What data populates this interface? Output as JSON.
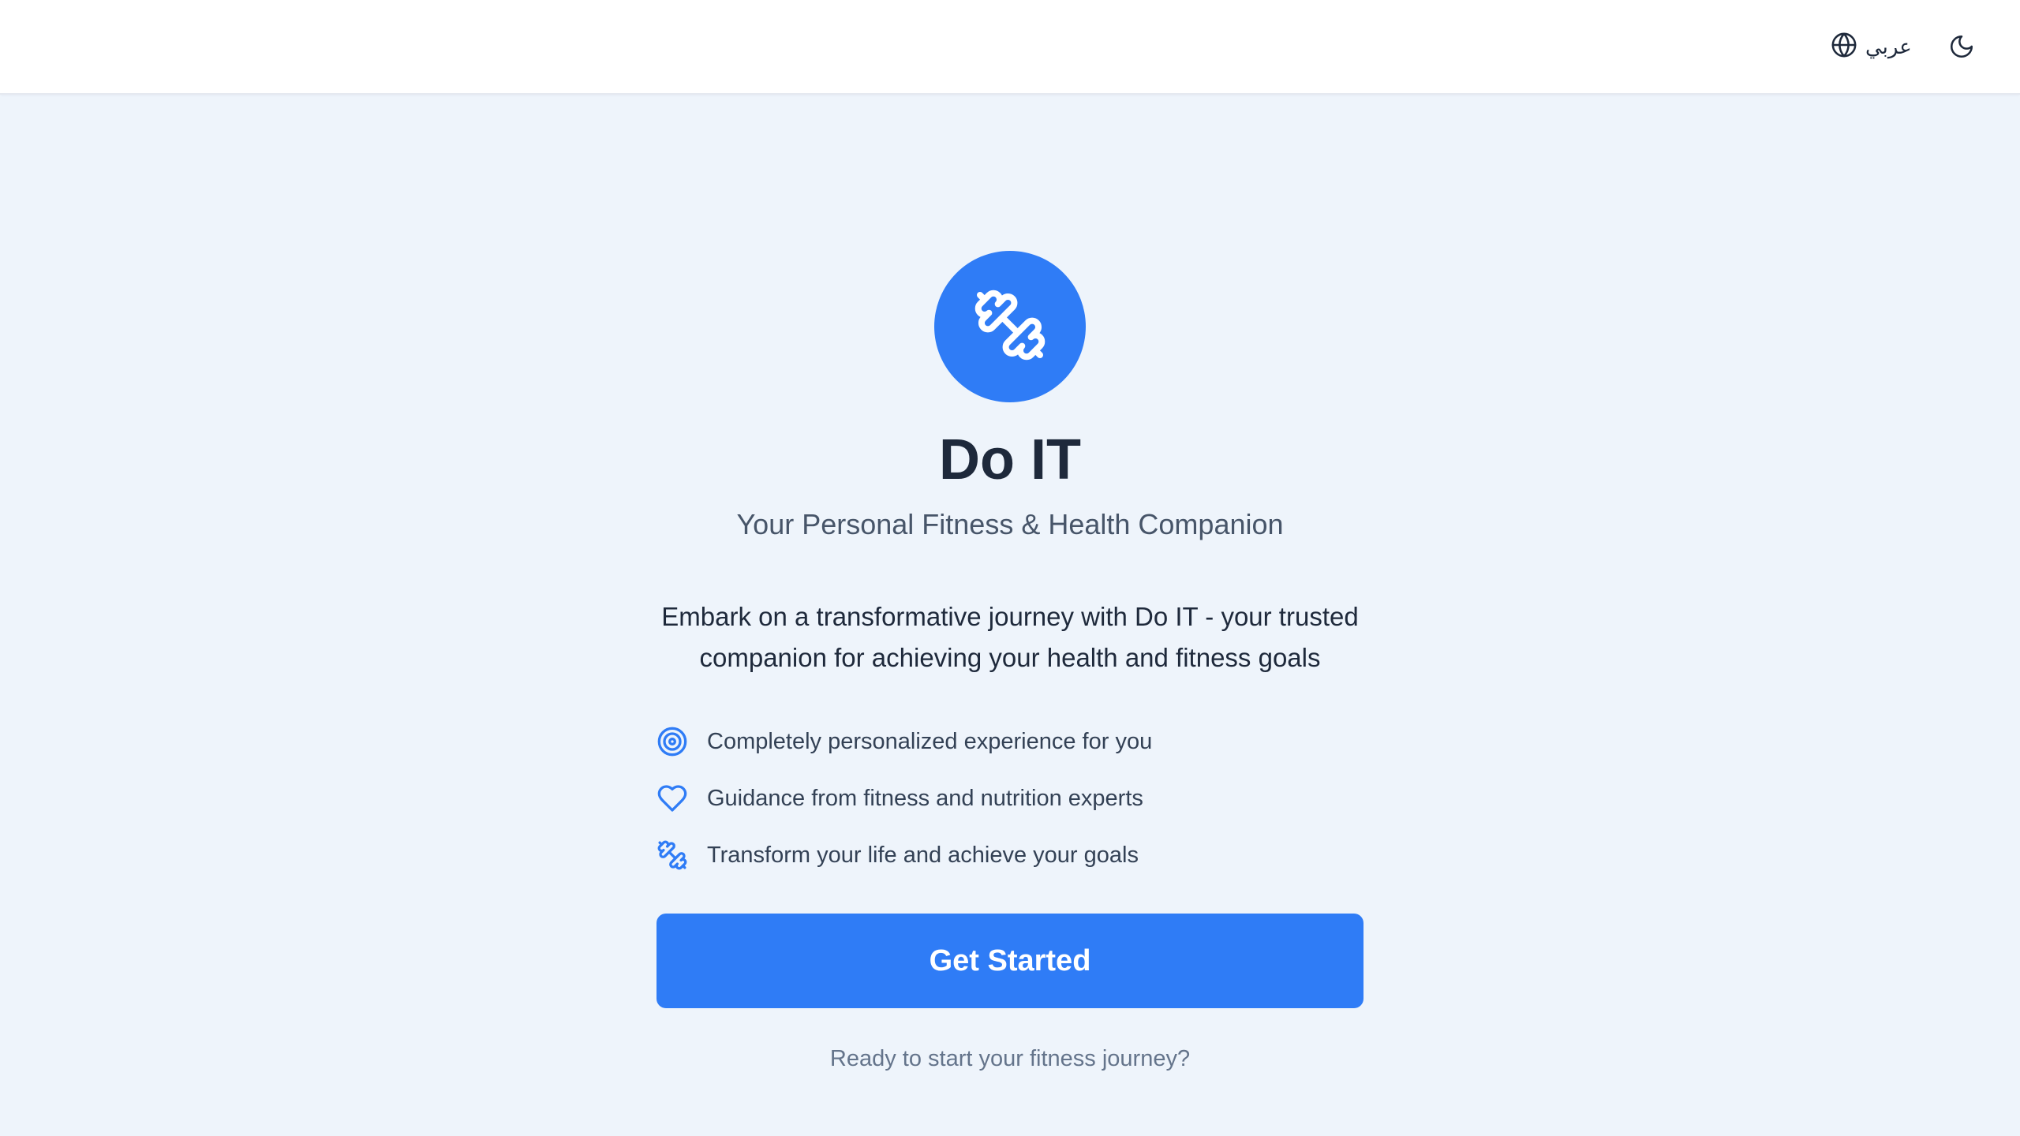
{
  "header": {
    "language_label": "عربي",
    "language_icon": "globe-icon",
    "theme_icon": "moon-icon"
  },
  "hero": {
    "logo_icon": "dumbbell-icon",
    "title": "Do IT",
    "tagline": "Your Personal Fitness & Health Companion",
    "description": "Embark on a transformative journey with Do IT - your trusted companion for achieving your health and fitness goals"
  },
  "features": [
    {
      "icon": "target-icon",
      "text": "Completely personalized experience for you"
    },
    {
      "icon": "heart-icon",
      "text": "Guidance from fitness and nutrition experts"
    },
    {
      "icon": "dumbbell-icon",
      "text": "Transform your life and achieve your goals"
    }
  ],
  "cta": {
    "label": "Get Started",
    "subtext": "Ready to start your fitness journey?"
  },
  "colors": {
    "accent": "#2f7cf6",
    "background": "#eef4fb",
    "header_bg": "#ffffff",
    "title_text": "#1e293b",
    "muted_text": "#64748b"
  }
}
